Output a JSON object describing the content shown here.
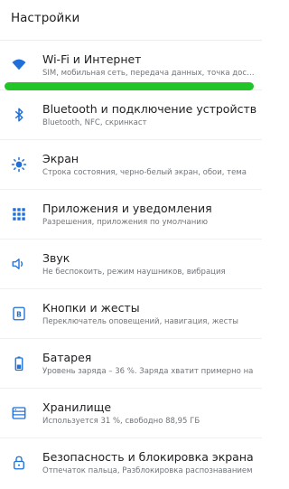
{
  "header": {
    "title": "Настройки"
  },
  "colors": {
    "icon": "#1e6fd9",
    "highlight": "#22c528"
  },
  "items": [
    {
      "icon": "wifi-icon",
      "title": "Wi-Fi и Интернет",
      "subtitle": "SIM, мобильная сеть, передача данных, точка доступа"
    },
    {
      "icon": "bluetooth-icon",
      "title": "Bluetooth и подключение устройств",
      "subtitle": "Bluetooth, NFC, скринкаст"
    },
    {
      "icon": "brightness-icon",
      "title": "Экран",
      "subtitle": "Строка состояния, черно-белый экран, обои, тема"
    },
    {
      "icon": "apps-grid-icon",
      "title": "Приложения и уведомления",
      "subtitle": "Разрешения, приложения по умолчанию"
    },
    {
      "icon": "sound-icon",
      "title": "Звук",
      "subtitle": "Не беспокоить, режим наушников, вибрация"
    },
    {
      "icon": "buttons-icon",
      "title": "Кнопки и жесты",
      "subtitle": "Переключатель оповещений, навигация, жесты"
    },
    {
      "icon": "battery-icon",
      "title": "Батарея",
      "subtitle": "Уровень заряда – 36 %. Заряда хватит примерно на"
    },
    {
      "icon": "storage-icon",
      "title": "Хранилище",
      "subtitle": "Используется 31 %, свободно 88,95 ГБ"
    },
    {
      "icon": "lock-icon",
      "title": "Безопасность и блокировка экрана",
      "subtitle": "Отпечаток пальца, Разблокировка распознаванием"
    }
  ]
}
